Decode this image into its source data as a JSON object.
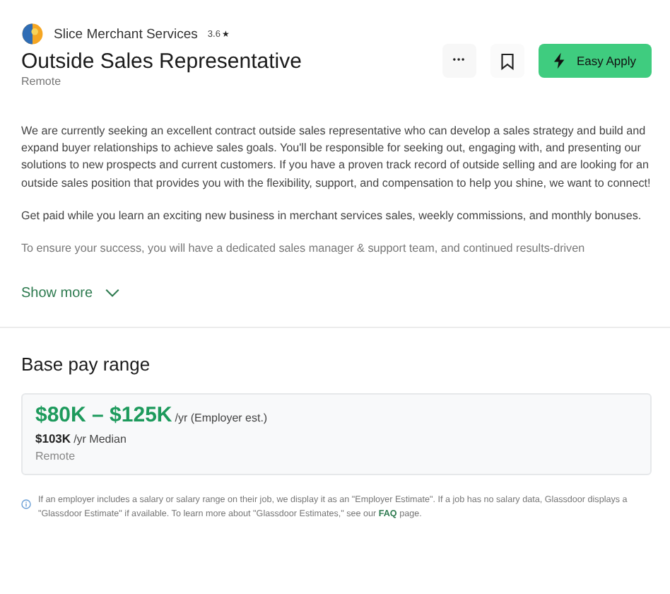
{
  "company": {
    "name": "Slice Merchant Services",
    "rating": "3.6",
    "star": "★"
  },
  "job": {
    "title": "Outside Sales Representative",
    "location": "Remote"
  },
  "actions": {
    "more": "•••",
    "apply": "Easy Apply"
  },
  "description": [
    "We are currently seeking an excellent contract outside sales representative who can develop a sales strategy and build and expand buyer relationships to achieve sales goals. You'll be responsible for seeking out, engaging with, and presenting our solutions to new prospects and current customers. If you have a proven track record of outside selling and are looking for an outside sales position that provides you with the flexibility, support, and compensation to help you shine, we want to connect!",
    "Get paid while you learn an exciting new business in merchant services sales, weekly commissions, and monthly bonuses.",
    "To ensure your success, you will have a dedicated sales manager & support team, and continued results-driven"
  ],
  "show_more": "Show more",
  "pay": {
    "heading": "Base pay range",
    "range": "$80K – $125K",
    "range_unit": "/yr (Employer est.)",
    "median": "$103K",
    "median_unit": "/yr Median",
    "location": "Remote"
  },
  "note": {
    "before": "If an employer includes a salary or salary range on their job, we display it as an \"Employer Estimate\". If a job has no salary data, Glassdoor displays a \"Glassdoor Estimate\" if available. To learn more about \"Glassdoor Estimates,\" see our",
    "link": "FAQ",
    "after": "page."
  }
}
